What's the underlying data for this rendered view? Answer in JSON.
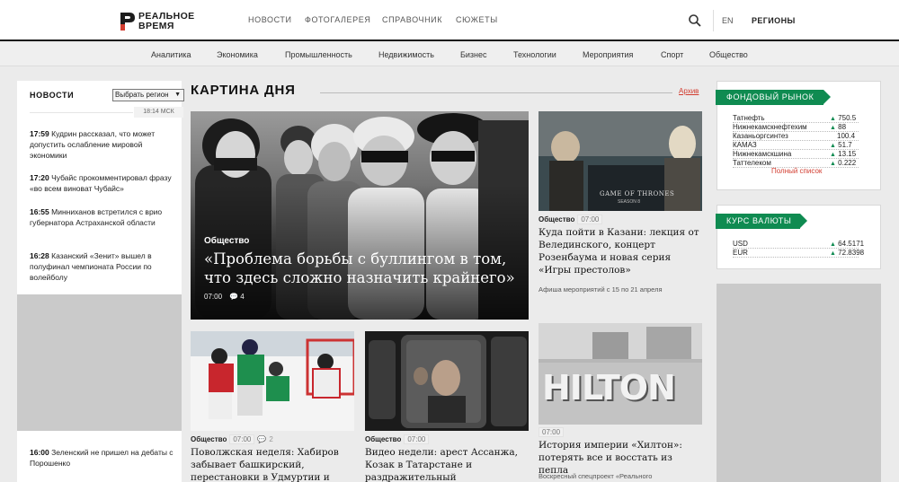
{
  "header": {
    "logo_line1": "РЕАЛЬНОЕ",
    "logo_line2": "ВРЕМЯ",
    "nav": [
      "НОВОСТИ",
      "ФОТОГАЛЕРЕЯ",
      "СПРАВОЧНИК",
      "СЮЖЕТЫ"
    ],
    "lang": "EN",
    "regions": "РЕГИОНЫ",
    "search_icon": "search-icon"
  },
  "categories": [
    "Аналитика",
    "Экономика",
    "Промышленность",
    "Недвижимость",
    "Бизнес",
    "Технологии",
    "Мероприятия",
    "Спорт",
    "Общество"
  ],
  "news_column": {
    "heading": "НОВОСТИ",
    "region_select": "Выбрать регион",
    "time": "18:14 МСК",
    "items": [
      {
        "time": "17:59",
        "text": "Кудрин рассказал, что может допустить ослабление мировой экономики"
      },
      {
        "time": "17:20",
        "text": "Чубайс прокомментировал фразу «во всем виноват Чубайс»"
      },
      {
        "time": "16:55",
        "text": "Минниханов встретился с врио губернатора Астраханской области"
      },
      {
        "time": "16:28",
        "text": "Казанский «Зенит» вышел в полуфинал чемпионата России по волейболу"
      },
      {
        "time": "16:00",
        "text": "Зеленский не пришел на дебаты с Порошенко"
      }
    ]
  },
  "main": {
    "section_title": "КАРТИНА ДНЯ",
    "archive": "Архив",
    "hero": {
      "category": "Общество",
      "title": "«Проблема борьбы с буллингом в том, что здесь сложно назначить крайнего»",
      "time": "07:00",
      "comments": "4"
    },
    "cards": [
      {
        "category": "Общество",
        "time": "07:00",
        "title": "Куда пойти в Казани: лекция от Велединского, концерт Розенбаума и новая серия «Игры престолов»",
        "sub": "Афиша мероприятий с 15 по 21 апреля",
        "image_text": "GAME OF THRONES",
        "image_sub": "SEASON 8"
      },
      {
        "category": "Общество",
        "time": "07:00",
        "comments": "2",
        "title": "Поволжская неделя: Хабиров забывает башкирский, перестановки в Удмуртии и"
      },
      {
        "category": "Общество",
        "time": "07:00",
        "title": "Видео недели: арест Ассанжа, Козак в Татарстане и раздражительный полузащитник"
      },
      {
        "category": "",
        "time": "07:00",
        "title": "История империи «Хилтон»: потерять все и восстать из пепла",
        "sub": "Воскресный спецпроект «Реального",
        "image_text": "HILTON"
      }
    ]
  },
  "stocks": {
    "heading": "ФОНДОВЫЙ РЫНОК",
    "items": [
      {
        "name": "Татнефть",
        "value": "750.5",
        "up": true
      },
      {
        "name": "Нижнекамскнефтехим",
        "value": "88",
        "up": true
      },
      {
        "name": "Казаньоргсинтез",
        "value": "100.4",
        "up": false
      },
      {
        "name": "КАМАЗ",
        "value": "51.7",
        "up": true
      },
      {
        "name": "Нижнекамскшина",
        "value": "13.15",
        "up": true
      },
      {
        "name": "Таттелеком",
        "value": "0.222",
        "up": true
      }
    ],
    "full_list": "Полный список"
  },
  "currency": {
    "heading": "КУРС ВАЛЮТЫ",
    "items": [
      {
        "name": "USD",
        "value": "64.5171",
        "up": true
      },
      {
        "name": "EUR",
        "value": "72.8398",
        "up": true
      }
    ]
  },
  "colors": {
    "accent_green": "#0f8b51",
    "accent_red": "#d23c2f"
  }
}
